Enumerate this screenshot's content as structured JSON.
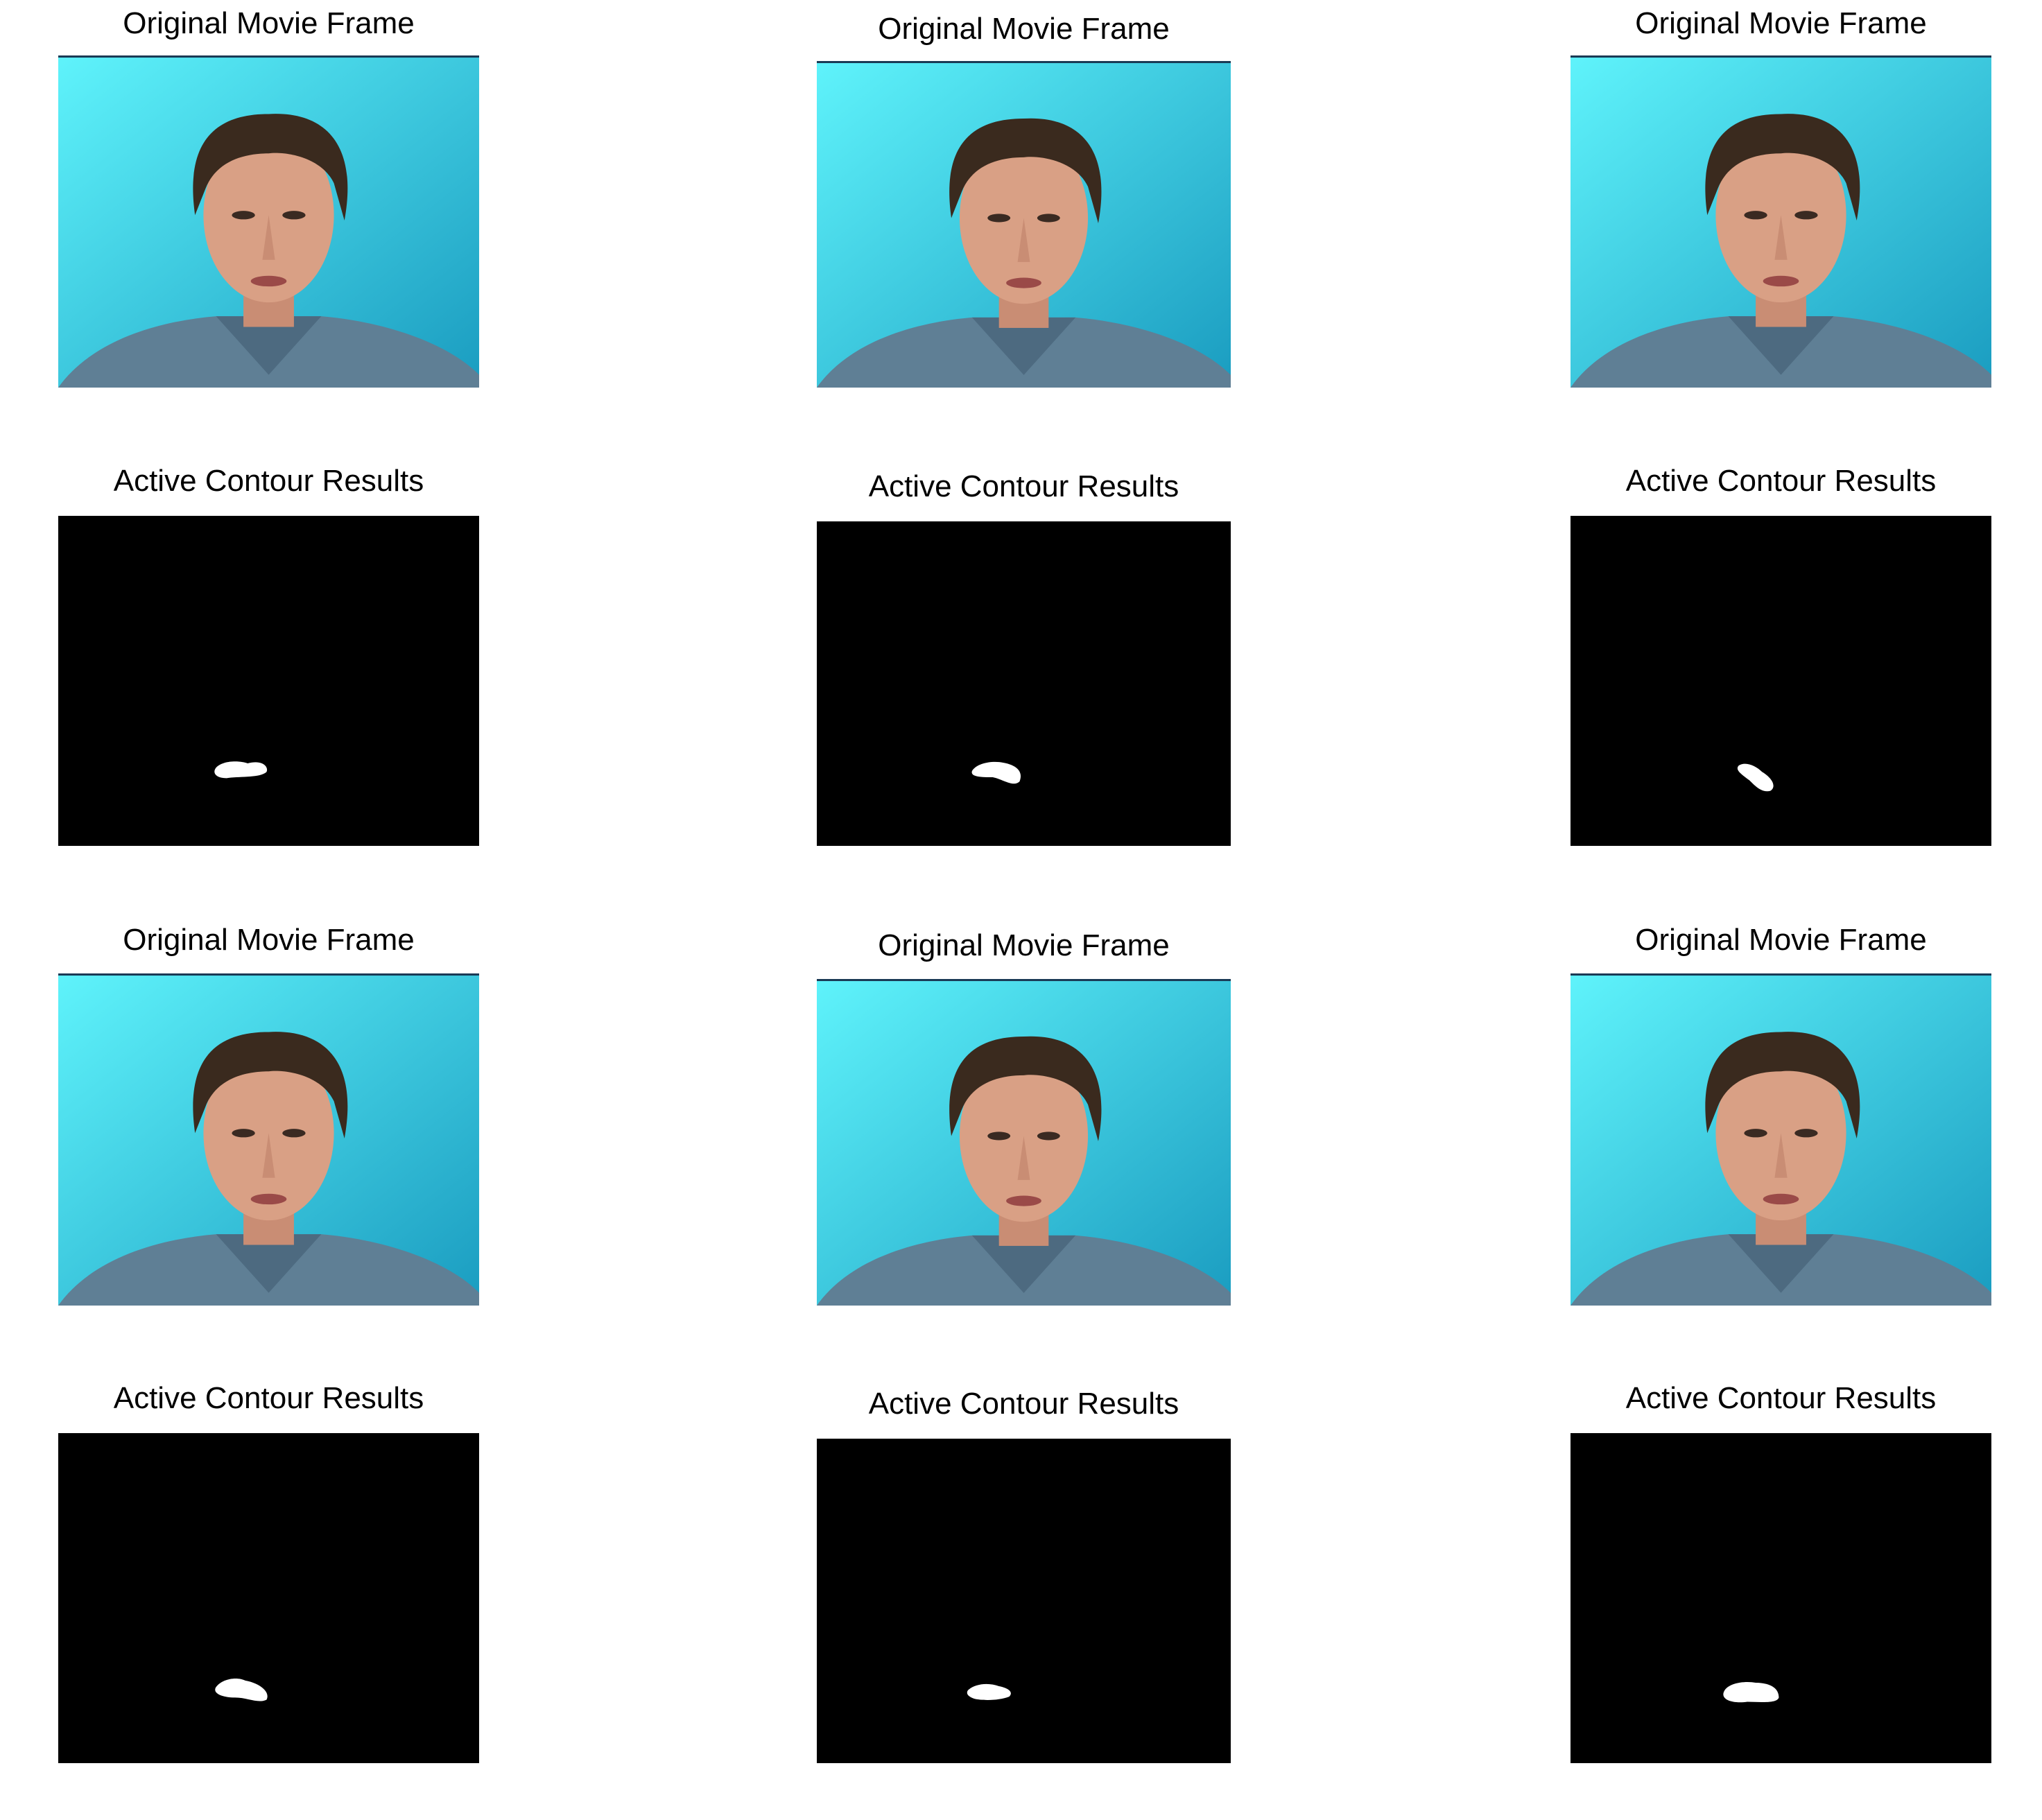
{
  "figure": {
    "columns": 3,
    "rows": [
      {
        "kind": "frame",
        "panels": [
          {
            "title": "Original Movie Frame",
            "image": "movie-frame-face"
          },
          {
            "title": "Original Movie Frame",
            "image": "movie-frame-face"
          },
          {
            "title": "Original Movie Frame",
            "image": "movie-frame-face"
          }
        ]
      },
      {
        "kind": "mask",
        "panels": [
          {
            "title": "Active Contour Results",
            "image": "segmentation-mask"
          },
          {
            "title": "Active Contour Results",
            "image": "segmentation-mask"
          },
          {
            "title": "Active Contour Results",
            "image": "segmentation-mask"
          }
        ]
      },
      {
        "kind": "frame",
        "panels": [
          {
            "title": "Original Movie Frame",
            "image": "movie-frame-face"
          },
          {
            "title": "Original Movie Frame",
            "image": "movie-frame-face"
          },
          {
            "title": "Original Movie Frame",
            "image": "movie-frame-face"
          }
        ]
      },
      {
        "kind": "mask",
        "panels": [
          {
            "title": "Active Contour Results",
            "image": "segmentation-mask"
          },
          {
            "title": "Active Contour Results",
            "image": "segmentation-mask"
          },
          {
            "title": "Active Contour Results",
            "image": "segmentation-mask"
          }
        ]
      }
    ],
    "colors": {
      "background_light": "#5ff3fb",
      "background_dark": "#1a9cc0",
      "hair": "#3a2a1e",
      "skin": "#d9a085",
      "shirt": "#5f7f95",
      "mask_bg": "#000000",
      "mask_blob": "#ffffff"
    }
  }
}
